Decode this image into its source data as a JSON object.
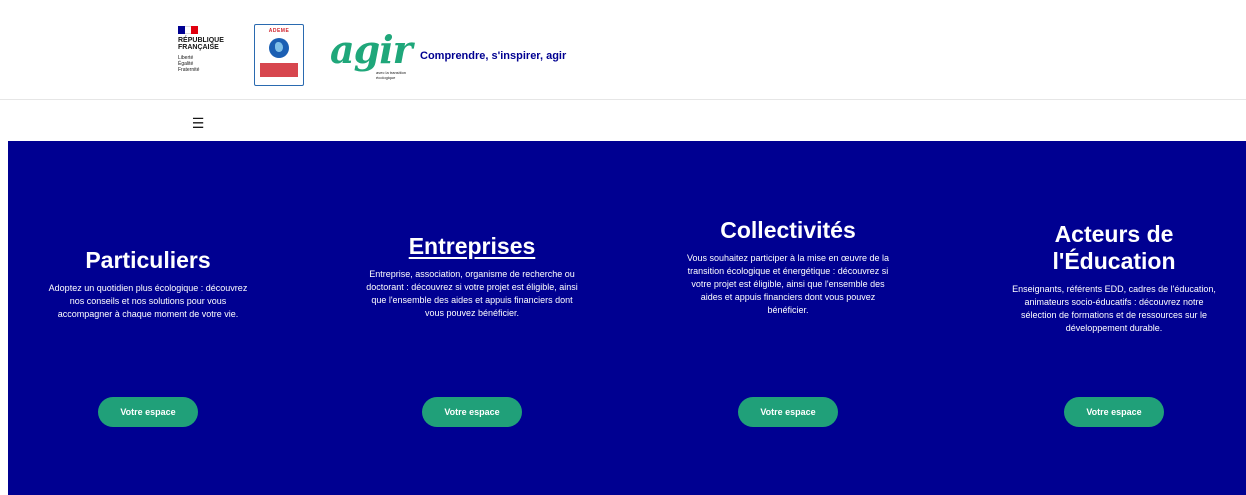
{
  "header": {
    "gov": {
      "title": "RÉPUBLIQUE FRANÇAISE",
      "motto": "Liberté\nÉgalité\nFraternité",
      "flag_colors": [
        "#000091",
        "#ffffff",
        "#e1000f"
      ]
    },
    "ademe_label": "ADEME",
    "agir": {
      "word": "agir",
      "sub": "avec la transition écologique"
    },
    "tagline": "Comprendre, s'inspirer, agir",
    "menu_icon": "☰"
  },
  "colors": {
    "band": "#000091",
    "button": "#20a079",
    "agir_green": "#1fa77a"
  },
  "audiences": [
    {
      "title": "Particuliers",
      "text": "Adoptez un quotidien plus écologique : découvrez nos conseils et nos solutions pour vous accompagner à chaque moment de votre vie.",
      "button": "Votre espace"
    },
    {
      "title": "Entreprises",
      "text": "Entreprise, association, organisme de recherche ou doctorant : découvrez si votre projet est éligible, ainsi que l'ensemble des aides et appuis financiers dont vous pouvez bénéficier.",
      "button": "Votre espace"
    },
    {
      "title": "Collectivités",
      "text": "Vous souhaitez participer à la mise en œuvre de la transition écologique et énergétique : découvrez si votre projet est éligible, ainsi que l'ensemble des aides et appuis financiers dont vous pouvez bénéficier.",
      "button": "Votre espace"
    },
    {
      "title": "Acteurs de l'Éducation",
      "text": "Enseignants, référents EDD, cadres de l'éducation, animateurs socio-éducatifs : découvrez notre sélection de formations et de ressources sur le développement durable.",
      "button": "Votre espace"
    }
  ]
}
